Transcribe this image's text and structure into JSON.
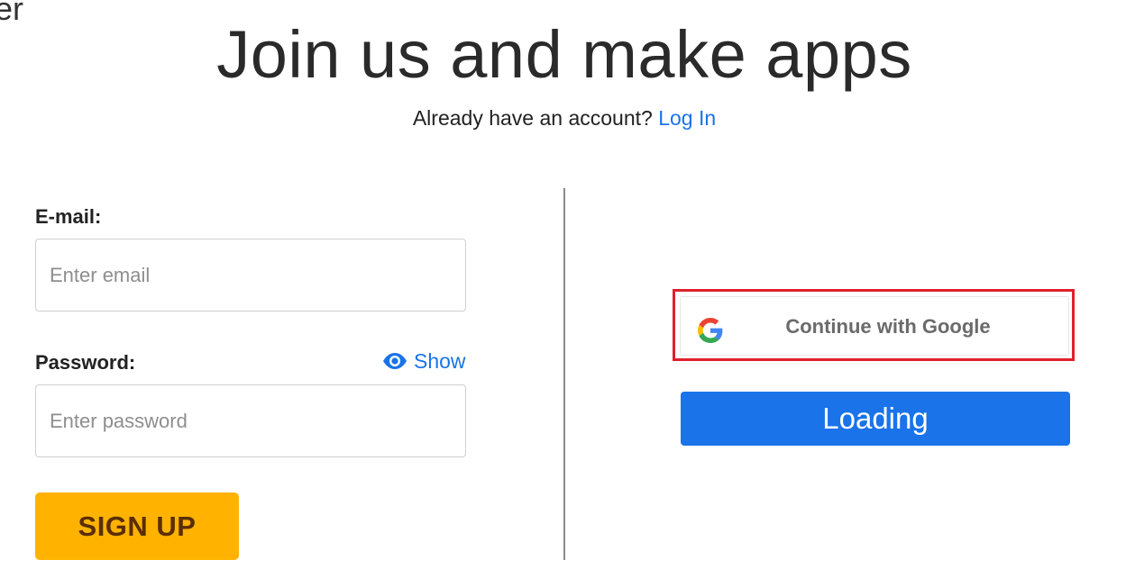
{
  "header": {
    "cut_text": "er",
    "title": "Join us and make apps",
    "account_prompt": "Already have an account?",
    "login_link": "Log In"
  },
  "form": {
    "email": {
      "label": "E-mail:",
      "placeholder": "Enter email",
      "value": ""
    },
    "password": {
      "label": "Password:",
      "placeholder": "Enter password",
      "value": "",
      "show_label": "Show",
      "show_icon": "eye-icon"
    },
    "signup_label": "SIGN UP"
  },
  "social": {
    "google_label": "Continue with Google",
    "google_icon": "google-logo-icon",
    "highlight_color": "#e0202c",
    "loading_label": "Loading"
  },
  "colors": {
    "accent_blue": "#1a73e8",
    "signup_bg": "#ffb300",
    "signup_text": "#5a2e00"
  }
}
